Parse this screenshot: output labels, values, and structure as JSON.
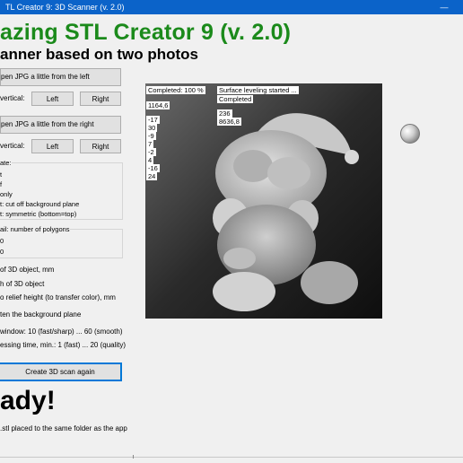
{
  "window": {
    "title": "TL Creator 9: 3D Scanner (v. 2.0)",
    "minimize_glyph": "—"
  },
  "header": {
    "title": "azing STL Creator 9 (v. 2.0)",
    "subtitle": "anner based on two photos"
  },
  "left_photo": {
    "open_label": "pen JPG a little from the left",
    "vertical_label": "vertical:",
    "btn_left": "Left",
    "btn_right": "Right"
  },
  "right_photo": {
    "open_label": "pen JPG a little from the right",
    "vertical_label": "vertical:",
    "btn_left": "Left",
    "btn_right": "Right"
  },
  "create_group": {
    "title": "ate:",
    "options": [
      "t",
      "f",
      "only",
      "t: cut off background plane",
      "t: symmetric (bottom=top)"
    ]
  },
  "detail_group": {
    "title": "ail: number of polygons",
    "options": [
      "0",
      "0"
    ]
  },
  "settings": [
    "of 3D object, mm",
    "h of 3D object",
    "o relief height (to transfer color), mm",
    "ten the background plane",
    "window: 10 (fast/sharp) ... 60 (smooth)",
    "essing time, min.: 1 (fast) ... 20 (quality)"
  ],
  "create_button": "Create 3D scan again",
  "status": {
    "ready": "ady!",
    "saved": ".stl placed to the same folder as the app"
  },
  "preview": {
    "completed": "Completed: 100 %",
    "leveling": "Surface leveling started ...",
    "leveling_done": "Completed",
    "value_a": "1164,6",
    "left_numbers": [
      "-17",
      "30",
      "-9",
      "7",
      "-2",
      "4",
      "-16",
      "24"
    ],
    "right_numbers": [
      "236",
      "8636,8"
    ]
  },
  "colors": {
    "titlebar": "#0b63c9",
    "title_green": "#1b8a1b"
  },
  "icons": {
    "preview_sphere": "shaded-sphere-icon"
  }
}
